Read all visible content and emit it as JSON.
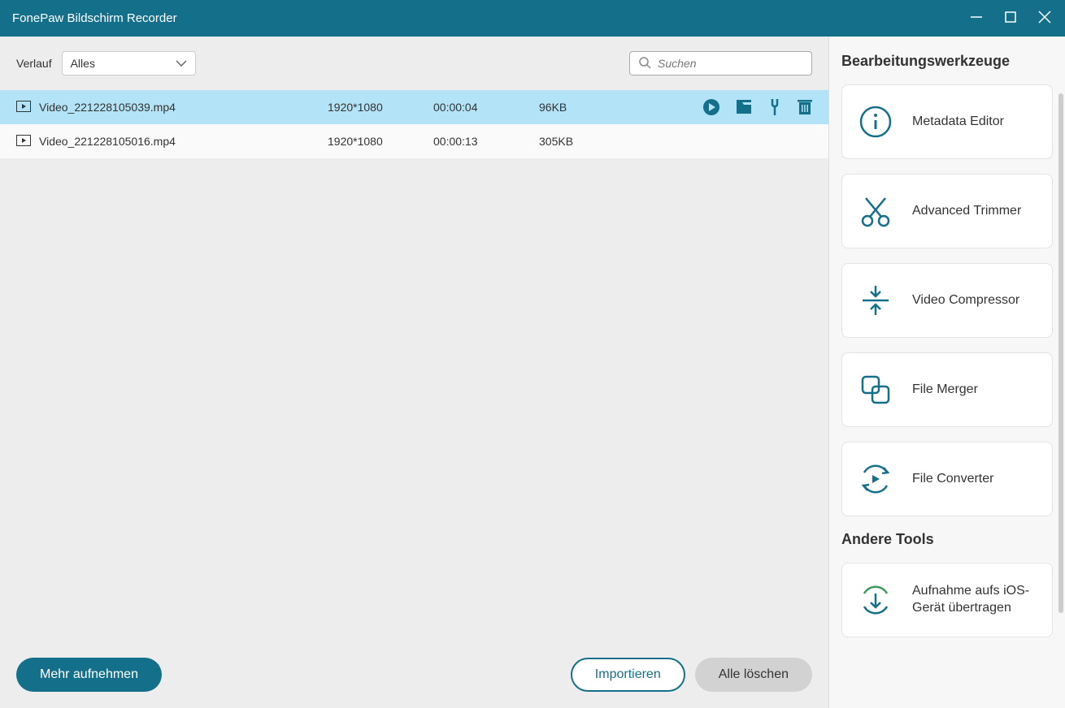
{
  "titlebar": {
    "title": "FonePaw Bildschirm Recorder"
  },
  "topbar": {
    "verlauf_label": "Verlauf",
    "filter_value": "Alles",
    "search_placeholder": "Suchen"
  },
  "rows": [
    {
      "name": "Video_221228105039.mp4",
      "resolution": "1920*1080",
      "duration": "00:00:04",
      "size": "96KB",
      "selected": true
    },
    {
      "name": "Video_221228105016.mp4",
      "resolution": "1920*1080",
      "duration": "00:00:13",
      "size": "305KB",
      "selected": false
    }
  ],
  "footer": {
    "record_more": "Mehr aufnehmen",
    "import": "Importieren",
    "delete_all": "Alle löschen"
  },
  "sidebar": {
    "tools_heading": "Bearbeitungswerkzeuge",
    "other_heading": "Andere Tools",
    "tools": [
      {
        "label": "Metadata Editor"
      },
      {
        "label": "Advanced Trimmer"
      },
      {
        "label": "Video Compressor"
      },
      {
        "label": "File Merger"
      },
      {
        "label": "File Converter"
      }
    ],
    "other": [
      {
        "label": "Aufnahme aufs iOS-Gerät übertragen"
      }
    ]
  },
  "colors": {
    "accent": "#14708a"
  }
}
